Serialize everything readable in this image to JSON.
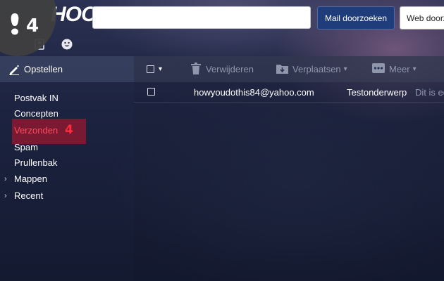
{
  "header": {
    "logo_text": "HOO!",
    "search": {
      "value": "",
      "placeholder": ""
    },
    "search_mail_label": "Mail doorzoeken",
    "search_web_label": "Web doorzoeken"
  },
  "step_badge": {
    "number": "4"
  },
  "compose": {
    "label": "Opstellen"
  },
  "toolbar": {
    "delete_label": "Verwijderen",
    "move_label": "Verplaatsen",
    "more_label": "Meer"
  },
  "folders": {
    "inbox": "Postvak IN",
    "drafts": "Concepten",
    "sent": "Verzonden",
    "sent_count": "4",
    "spam": "Spam",
    "trash": "Prullenbak",
    "folders": "Mappen",
    "recent": "Recent"
  },
  "messages": [
    {
      "from": "howyoudothis84@yahoo.com",
      "subject": "Testonderwerp",
      "snippet": "Dit is ee"
    }
  ],
  "colors": {
    "accent": "#1f3d7a",
    "selected_text": "#ff4a5e",
    "selected_bg": "#b4142a"
  }
}
